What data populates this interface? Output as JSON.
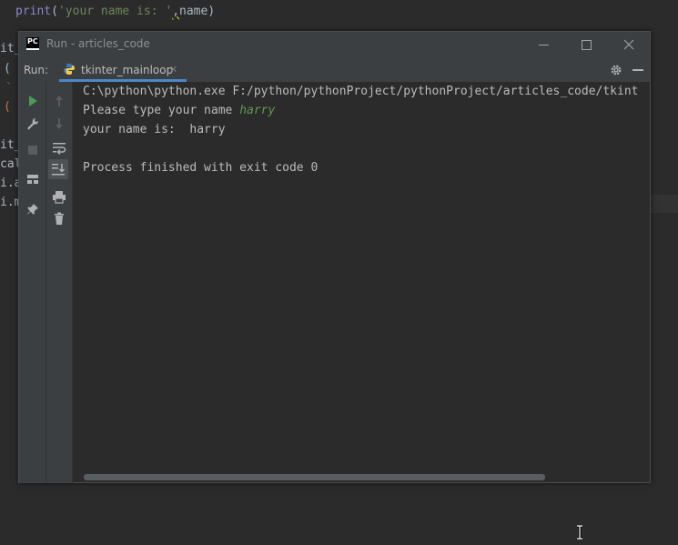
{
  "editor": {
    "code": {
      "func": "print",
      "open": "(",
      "string": "'your name is: '",
      "comma": ",",
      "arg": "name",
      "close": ")"
    },
    "edge_fragments": [
      "it_",
      "(",
      "`",
      "(",
      "it_",
      "cal",
      "i.a",
      "i.m"
    ]
  },
  "window": {
    "app_icon": "PC",
    "title": "Run - articles_code"
  },
  "run_panel": {
    "run_label": "Run:",
    "tab_label": "tkinter_mainloop"
  },
  "console": {
    "command": "C:\\python\\python.exe F:/python/pythonProject/pythonProject/articles_code/tkint",
    "prompt": "Please type your name ",
    "user_input": "harry",
    "output": "your name is:  harry",
    "blank": "",
    "exit_message": "Process finished with exit code 0"
  },
  "colors": {
    "accent": "#4a88c7",
    "run_green": "#499c54",
    "user_input": "#629755"
  }
}
